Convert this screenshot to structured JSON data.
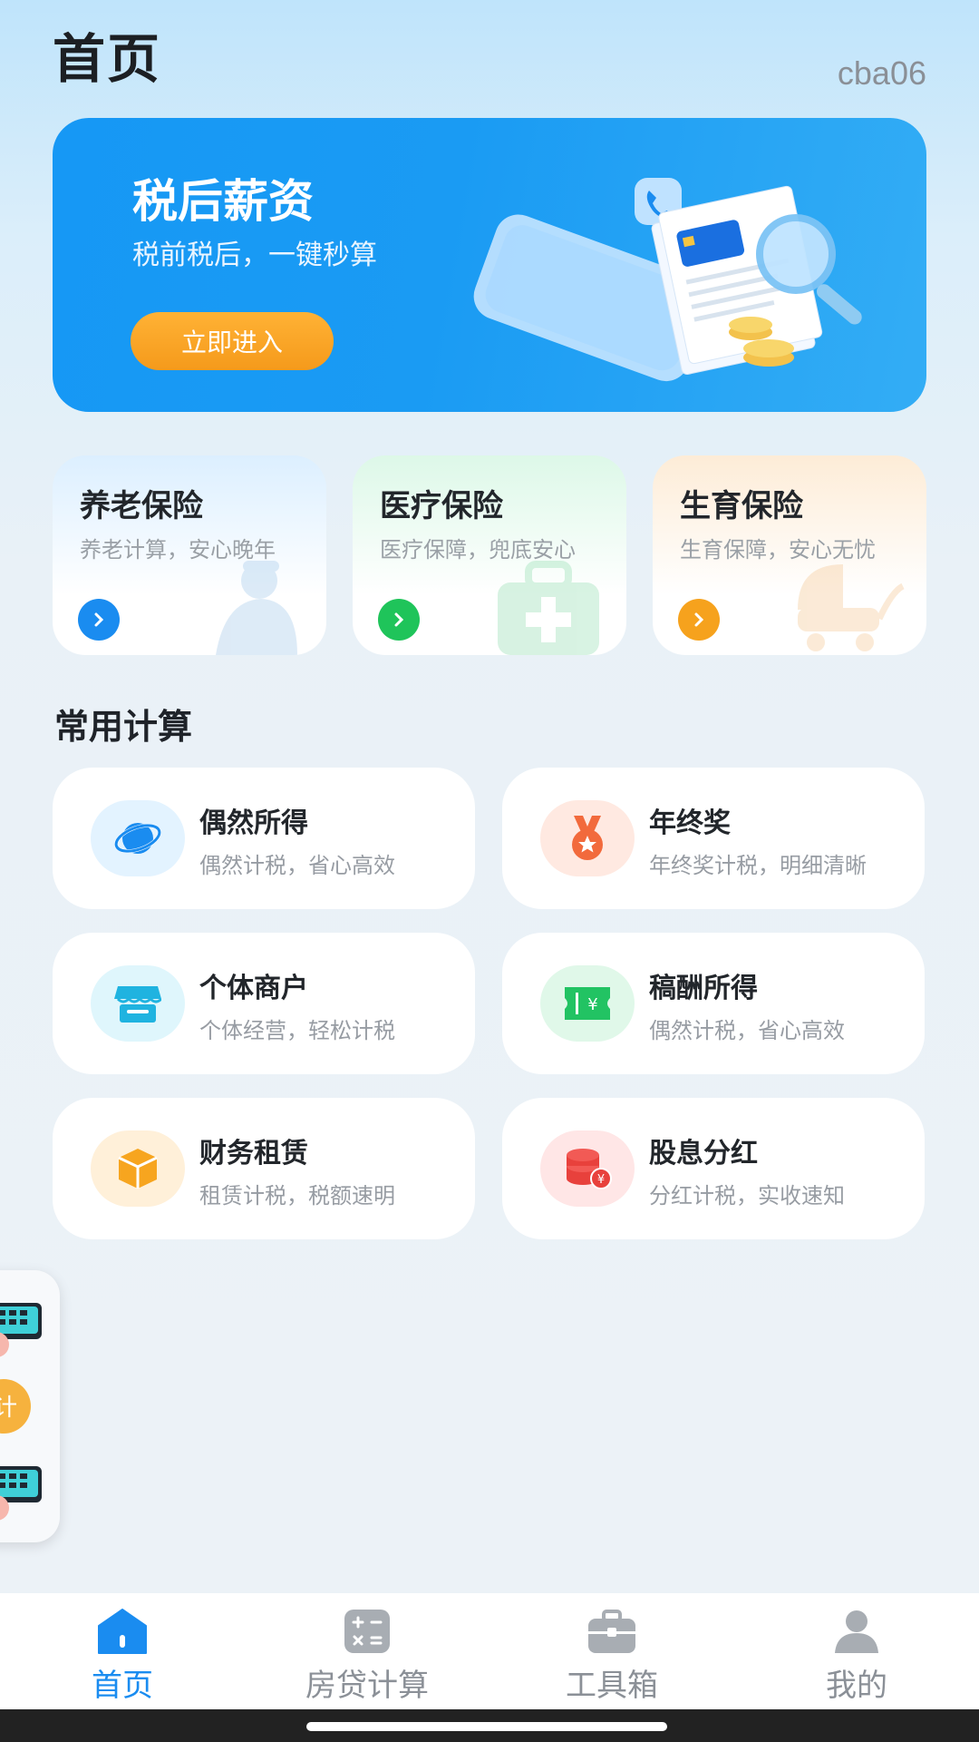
{
  "header": {
    "title": "首页",
    "user": "cba06"
  },
  "banner": {
    "title": "税后薪资",
    "subtitle": "税前税后，一键秒算",
    "button": "立即进入",
    "color": "#1698f5"
  },
  "insurance": [
    {
      "title": "养老保险",
      "subtitle": "养老计算，安心晚年",
      "accent": "#1a8cf0",
      "icon": "elderly-person-icon"
    },
    {
      "title": "医疗保险",
      "subtitle": "医疗保障，兜底安心",
      "accent": "#1fc45a",
      "icon": "medical-kit-icon"
    },
    {
      "title": "生育保险",
      "subtitle": "生育保障，安心无忧",
      "accent": "#f6a21d",
      "icon": "baby-stroller-icon"
    }
  ],
  "section": {
    "title": "常用计算"
  },
  "calculators": [
    {
      "title": "偶然所得",
      "subtitle": "偶然计税，省心高效",
      "icon": "orbit-icon"
    },
    {
      "title": "年终奖",
      "subtitle": "年终奖计税，明细清晰",
      "icon": "medal-icon"
    },
    {
      "title": "个体商户",
      "subtitle": "个体经营，轻松计税",
      "icon": "shop-icon"
    },
    {
      "title": "稿酬所得",
      "subtitle": "偶然计税，省心高效",
      "icon": "ticket-icon"
    },
    {
      "title": "财务租赁",
      "subtitle": "租赁计税，税额速明",
      "icon": "box-icon"
    },
    {
      "title": "股息分红",
      "subtitle": "分红计税，实收速知",
      "icon": "coins-icon"
    }
  ],
  "nav": {
    "items": [
      {
        "label": "首页",
        "icon": "home-icon",
        "active": true
      },
      {
        "label": "房贷计算",
        "icon": "calculator-icon",
        "active": false
      },
      {
        "label": "工具箱",
        "icon": "toolbox-icon",
        "active": false
      },
      {
        "label": "我的",
        "icon": "user-icon",
        "active": false
      }
    ]
  },
  "float_widget": {
    "badge_text": "计"
  }
}
